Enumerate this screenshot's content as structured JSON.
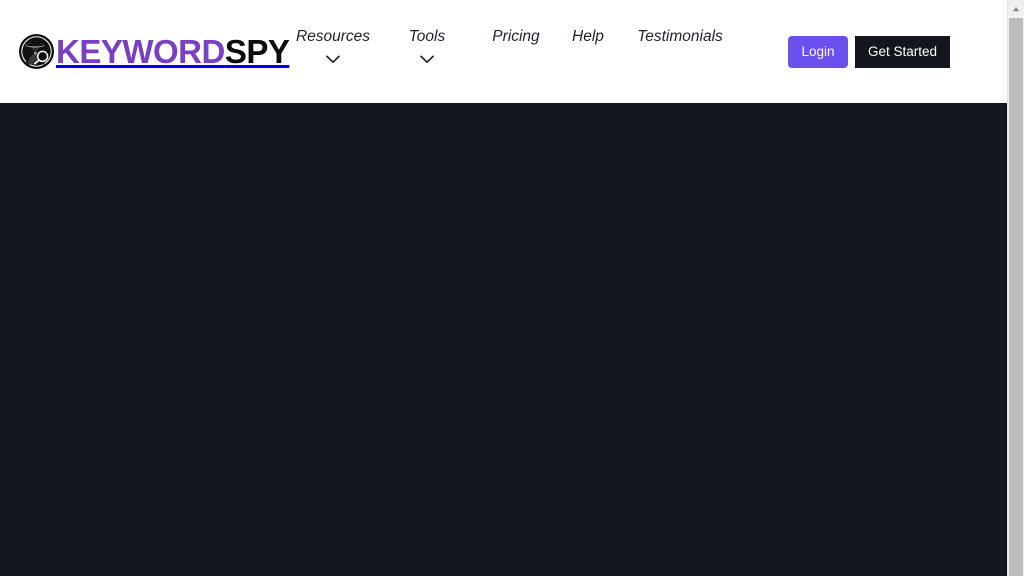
{
  "page": {
    "background_color": "#ffffff",
    "hero_background_color": "#14161f"
  },
  "header": {
    "logo": {
      "icon_name": "spy-detective-magnifier-icon",
      "text_primary": "KEYWORD",
      "text_secondary": "SPY",
      "primary_color": "#7b3fc4",
      "secondary_color": "#0b0b0b"
    },
    "nav": {
      "items": [
        {
          "label": "Resources",
          "has_dropdown": true
        },
        {
          "label": "Tools",
          "has_dropdown": true
        },
        {
          "label": "Pricing",
          "has_dropdown": false
        },
        {
          "label": "Help",
          "has_dropdown": false
        },
        {
          "label": "Testimonials",
          "has_dropdown": false
        }
      ],
      "text_color": "#1e2230",
      "dropdown_icon_name": "chevron-down-icon"
    },
    "actions": {
      "login_label": "Login",
      "login_color": "#6b50ee",
      "get_started_label": "Get Started",
      "get_started_color": "#14161f"
    }
  },
  "scrollbar": {
    "up_arrow_icon": "caret-up-icon",
    "track_color": "#f0f0f0",
    "thumb_color": "#bdbdbd"
  }
}
